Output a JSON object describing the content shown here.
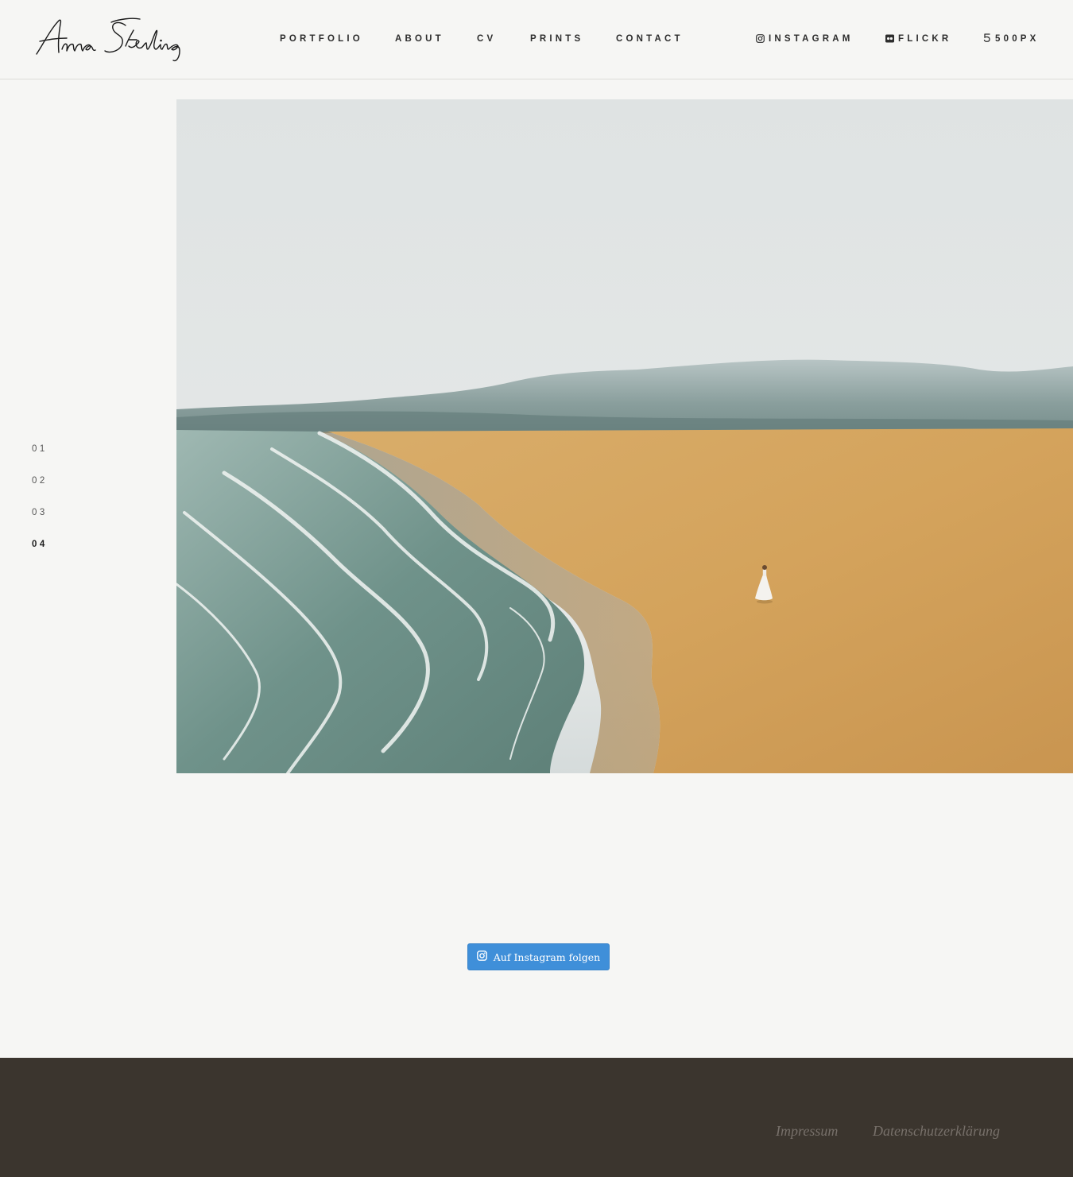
{
  "brand": {
    "name": "Anna Sterling"
  },
  "nav": {
    "items": [
      {
        "label": "PORTFOLIO"
      },
      {
        "label": "ABOUT"
      },
      {
        "label": "CV"
      },
      {
        "label": "PRINTS"
      },
      {
        "label": "CONTACT"
      }
    ]
  },
  "social": {
    "items": [
      {
        "label": "INSTAGRAM",
        "icon": "instagram-icon"
      },
      {
        "label": "FLICKR",
        "icon": "flickr-icon"
      },
      {
        "label": "500PX",
        "icon": "500px-icon"
      }
    ]
  },
  "slider": {
    "items": [
      "01",
      "02",
      "03",
      "04"
    ],
    "active_index": 3
  },
  "hero": {
    "subject": "aerial-beach-photo",
    "icon": "photo"
  },
  "instagram_button": {
    "label": "Auf Instagram folgen",
    "icon": "instagram-icon",
    "color": "#3f8fd9"
  },
  "footer": {
    "links": [
      {
        "label": "Impressum"
      },
      {
        "label": "Datenschutzerklärung"
      }
    ],
    "background": "#3b352e"
  }
}
